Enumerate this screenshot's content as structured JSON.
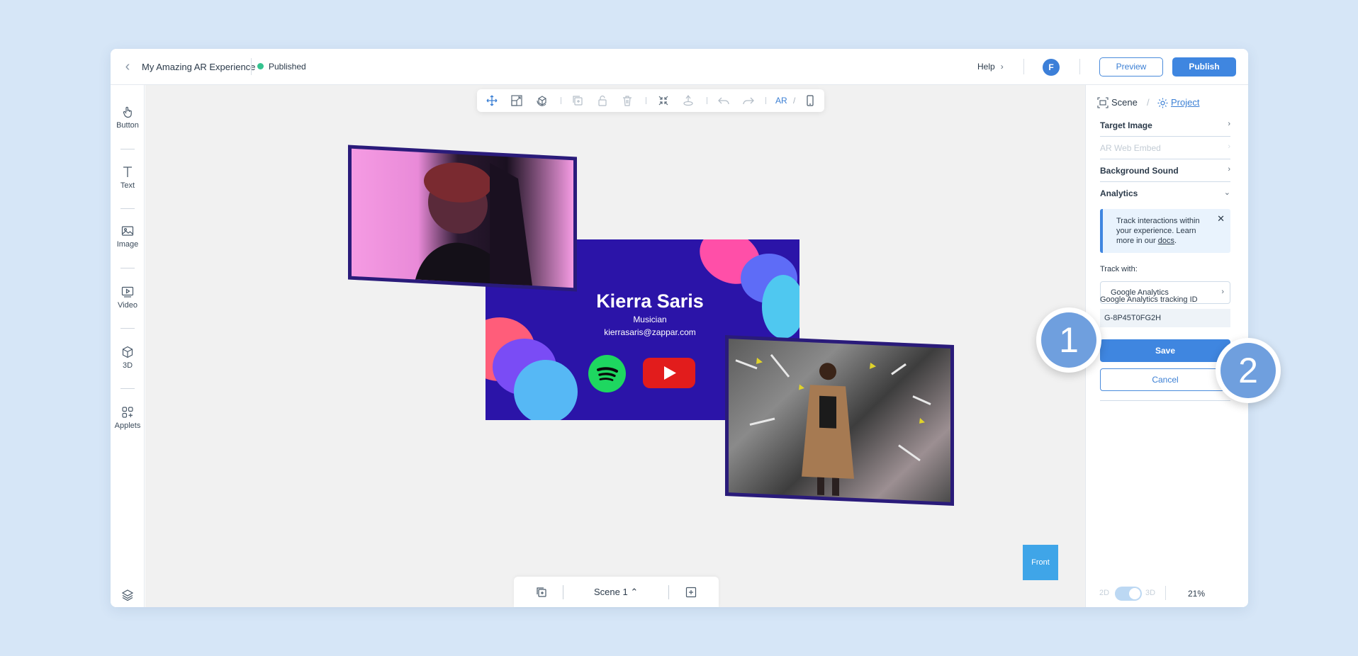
{
  "topbar": {
    "project_title": "My Amazing AR Experience",
    "status": "Published",
    "help_label": "Help",
    "avatar_initial": "F",
    "preview_label": "Preview",
    "publish_label": "Publish"
  },
  "left_tools": [
    {
      "label": "Button",
      "icon": "hand-pointer-icon"
    },
    {
      "label": "Text",
      "icon": "text-t-icon"
    },
    {
      "label": "Image",
      "icon": "image-icon"
    },
    {
      "label": "Video",
      "icon": "video-icon"
    },
    {
      "label": "3D",
      "icon": "cube-icon"
    },
    {
      "label": "Applets",
      "icon": "applets-icon"
    }
  ],
  "float_toolbar": {
    "ar_label": "AR",
    "slash": "/",
    "icons": [
      "move-icon",
      "scale-icon",
      "rotate-icon",
      "duplicate-icon",
      "lock-icon",
      "delete-icon",
      "fit-icon",
      "anchor-icon",
      "undo-icon",
      "redo-icon",
      "phone-icon"
    ]
  },
  "card": {
    "name": "Kierra Saris",
    "role": "Musician",
    "email": "kierrasaris@zappar.com"
  },
  "canvas": {
    "front_label": "Front",
    "scene_label": "Scene 1"
  },
  "right_panel": {
    "tab_scene": "Scene",
    "tab_sep": "/",
    "tab_project": "Project",
    "sections": {
      "target_image": "Target Image",
      "ar_web_embed": "AR Web Embed",
      "background_sound": "Background Sound",
      "analytics": "Analytics"
    },
    "info_text": "Track interactions within your experience. Learn more in our",
    "info_link": "docs",
    "info_end": ".",
    "track_with_label": "Track with:",
    "track_with_value": "Google Analytics",
    "tracking_id_label": "Google Analytics tracking ID",
    "tracking_id_value": "G-8P45T0FG2H",
    "save_label": "Save",
    "cancel_label": "Cancel",
    "toggle_2d": "2D",
    "toggle_3d": "3D",
    "zoom": "21%"
  },
  "markers": {
    "one": "1",
    "two": "2"
  },
  "colors": {
    "accent": "#3f86e0",
    "status_published": "#34c38f",
    "card_bg": "#2b14a8",
    "front_button": "#3fa5e8"
  }
}
